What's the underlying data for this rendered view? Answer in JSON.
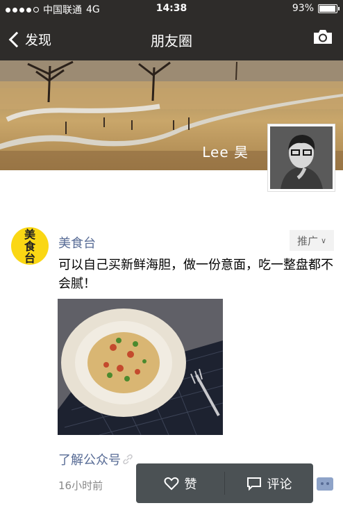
{
  "status_bar": {
    "carrier": "中国联通",
    "network": "4G",
    "time": "14:38",
    "battery": "93%"
  },
  "nav": {
    "back_label": "发现",
    "title": "朋友圈",
    "camera_icon": "camera-icon"
  },
  "profile": {
    "username": "Lee 昊"
  },
  "post": {
    "avatar_text": "美食台",
    "account_name": "美食台",
    "promo_label": "推广",
    "text": "可以自己买新鲜海胆，做一份意面，吃一整盘都不会腻！",
    "link_label": "了解公众号",
    "time": "16小时前"
  },
  "actions": {
    "like_label": "赞",
    "comment_label": "评论"
  },
  "colors": {
    "link_blue": "#576b95",
    "bar_bg": "#2e2c2a",
    "popup_bg": "#4b5154",
    "avatar_yellow": "#fad714"
  }
}
